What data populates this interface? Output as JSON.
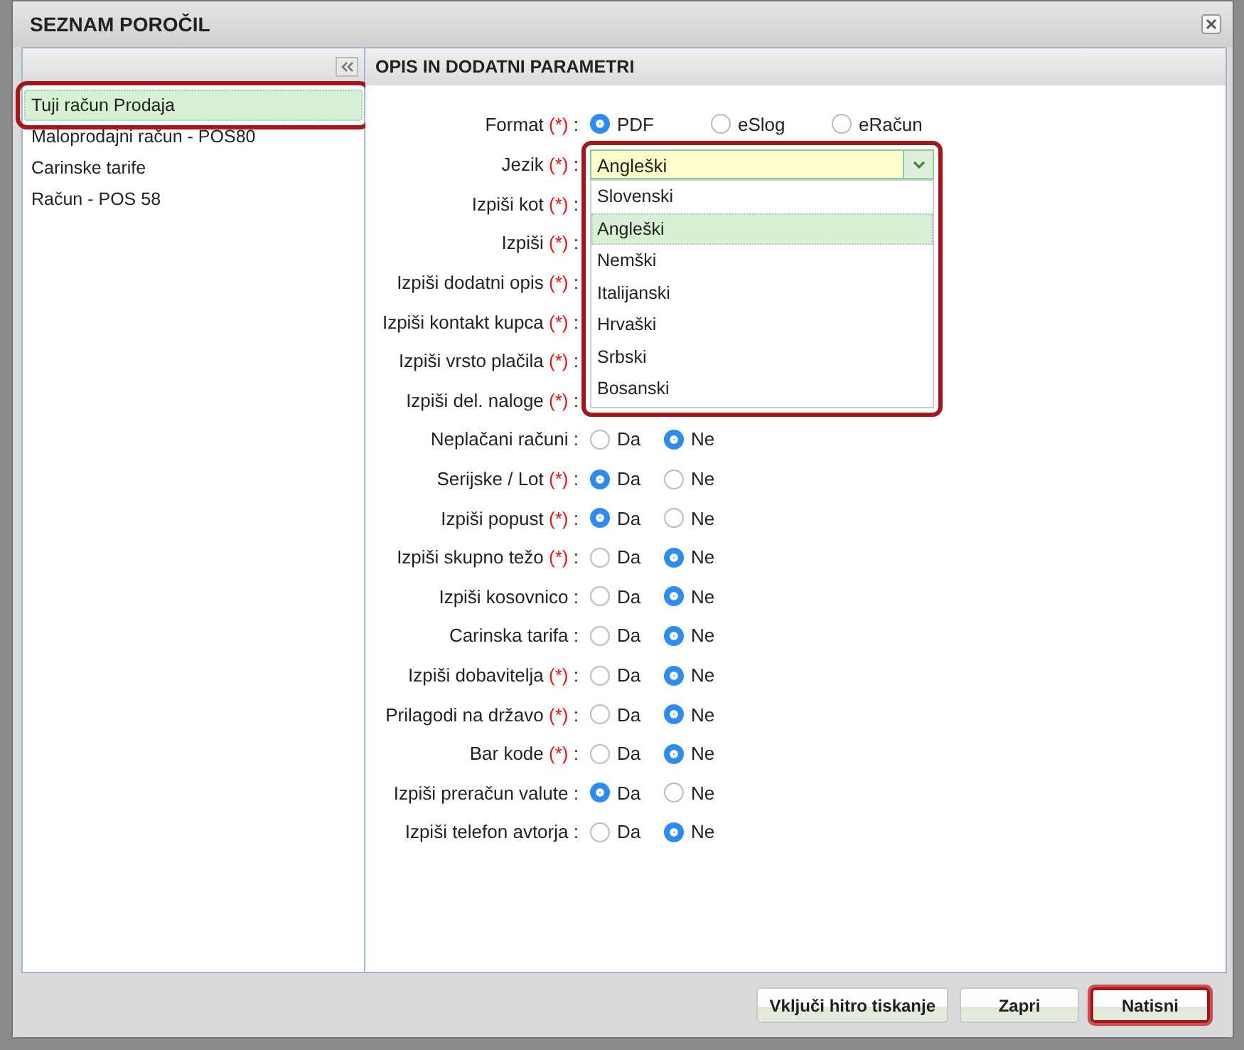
{
  "window": {
    "title": "SEZNAM POROČIL"
  },
  "reports": [
    {
      "label": "Tuji račun Prodaja",
      "selected": true,
      "highlighted": true
    },
    {
      "label": "Maloprodajni račun - POS80",
      "selected": false,
      "highlighted": false
    },
    {
      "label": "Carinske tarife",
      "selected": false,
      "highlighted": false
    },
    {
      "label": "Račun - POS 58",
      "selected": false,
      "highlighted": false
    }
  ],
  "params": {
    "title": "OPIS IN DODATNI PARAMETRI",
    "rows": [
      {
        "kind": "format",
        "label": "Format",
        "mark": "(*)",
        "sep": ":",
        "options": [
          {
            "label": "PDF",
            "selected": true
          },
          {
            "label": "eSlog",
            "selected": false
          },
          {
            "label": "eRačun",
            "selected": false
          }
        ]
      },
      {
        "kind": "select",
        "label": "Jezik",
        "mark": "(*)",
        "sep": ":",
        "value": "Angleški",
        "highlighted": true,
        "expanded": true,
        "options": [
          {
            "label": "Slovenski",
            "selected": false
          },
          {
            "label": "Angleški",
            "selected": true
          },
          {
            "label": "Nemški",
            "selected": false
          },
          {
            "label": "Italijanski",
            "selected": false
          },
          {
            "label": "Hrvaški",
            "selected": false
          },
          {
            "label": "Srbski",
            "selected": false
          },
          {
            "label": "Bosanski",
            "selected": false
          }
        ]
      },
      {
        "kind": "covered",
        "label": "Izpiši kot",
        "mark": "(*)",
        "sep": ":"
      },
      {
        "kind": "covered",
        "label": "Izpiši",
        "mark": "(*)",
        "sep": ":"
      },
      {
        "kind": "covered",
        "label": "Izpiši dodatni opis",
        "mark": "(*)",
        "sep": ":"
      },
      {
        "kind": "covered",
        "label": "Izpiši kontakt kupca",
        "mark": "(*)",
        "sep": ":"
      },
      {
        "kind": "covered",
        "label": "Izpiši vrsto plačila",
        "mark": "(*)",
        "sep": ":"
      },
      {
        "kind": "covered",
        "label": "Izpiši del. naloge",
        "mark": "(*)",
        "sep": ":"
      },
      {
        "kind": "yesno",
        "label": "Neplačani računi",
        "sep": ":",
        "options": [
          {
            "label": "Da",
            "selected": false
          },
          {
            "label": "Ne",
            "selected": true
          }
        ]
      },
      {
        "kind": "yesno",
        "label": "Serijske / Lot",
        "mark": "(*)",
        "sep": ":",
        "options": [
          {
            "label": "Da",
            "selected": true
          },
          {
            "label": "Ne",
            "selected": false
          }
        ]
      },
      {
        "kind": "yesno",
        "label": "Izpiši popust",
        "mark": "(*)",
        "sep": ":",
        "options": [
          {
            "label": "Da",
            "selected": true
          },
          {
            "label": "Ne",
            "selected": false
          }
        ]
      },
      {
        "kind": "yesno",
        "label": "Izpiši skupno težo",
        "mark": "(*)",
        "sep": ":",
        "options": [
          {
            "label": "Da",
            "selected": false
          },
          {
            "label": "Ne",
            "selected": true
          }
        ]
      },
      {
        "kind": "yesno",
        "label": "Izpiši kosovnico",
        "sep": ":",
        "options": [
          {
            "label": "Da",
            "selected": false
          },
          {
            "label": "Ne",
            "selected": true
          }
        ]
      },
      {
        "kind": "yesno",
        "label": "Carinska tarifa",
        "sep": ":",
        "options": [
          {
            "label": "Da",
            "selected": false
          },
          {
            "label": "Ne",
            "selected": true
          }
        ]
      },
      {
        "kind": "yesno",
        "label": "Izpiši dobavitelja",
        "mark": "(*)",
        "sep": ":",
        "options": [
          {
            "label": "Da",
            "selected": false
          },
          {
            "label": "Ne",
            "selected": true
          }
        ]
      },
      {
        "kind": "yesno",
        "label": "Prilagodi na državo",
        "mark": "(*)",
        "sep": ":",
        "options": [
          {
            "label": "Da",
            "selected": false
          },
          {
            "label": "Ne",
            "selected": true
          }
        ]
      },
      {
        "kind": "yesno",
        "label": "Bar kode",
        "mark": "(*)",
        "sep": ":",
        "options": [
          {
            "label": "Da",
            "selected": false
          },
          {
            "label": "Ne",
            "selected": true
          }
        ]
      },
      {
        "kind": "yesno",
        "label": "Izpiši preračun valute",
        "sep": ":",
        "options": [
          {
            "label": "Da",
            "selected": true
          },
          {
            "label": "Ne",
            "selected": false
          }
        ]
      },
      {
        "kind": "yesno",
        "label": "Izpiši telefon avtorja",
        "sep": ":",
        "options": [
          {
            "label": "Da",
            "selected": false
          },
          {
            "label": "Ne",
            "selected": true
          }
        ]
      }
    ]
  },
  "buttons": [
    {
      "label": "Vključi hitro tiskanje",
      "highlighted": false
    },
    {
      "label": "Zapri",
      "highlighted": false
    },
    {
      "label": "Natisni",
      "highlighted": true
    }
  ]
}
